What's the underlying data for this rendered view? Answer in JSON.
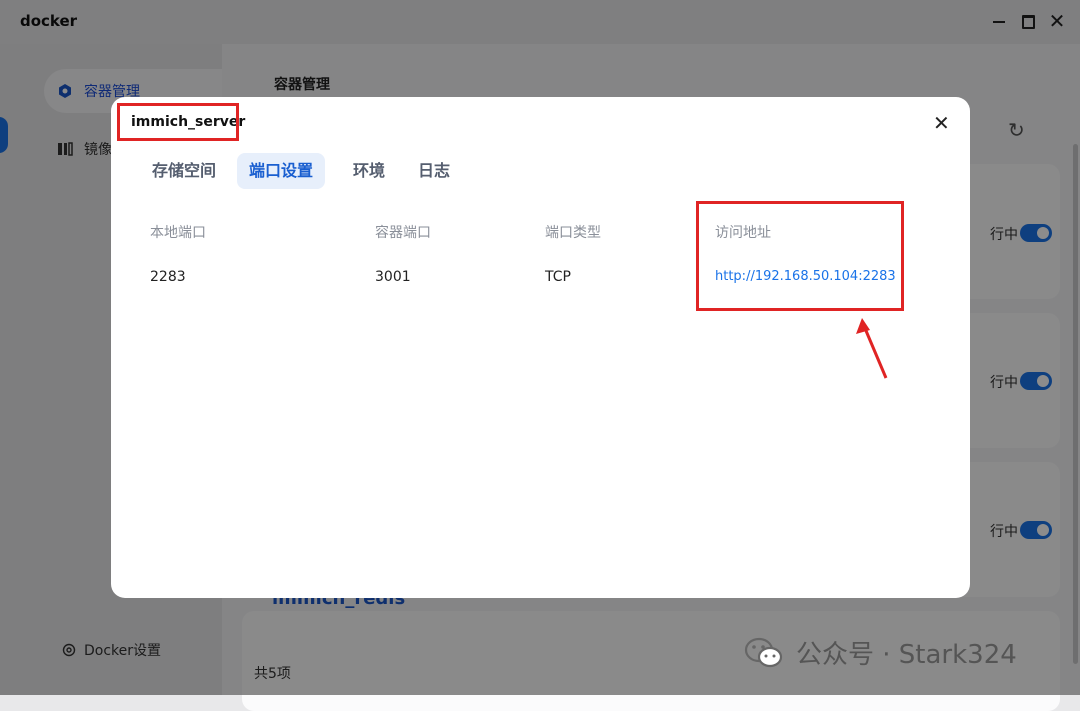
{
  "window": {
    "title": "docker"
  },
  "sidebar": {
    "items": [
      {
        "label": "容器管理",
        "icon": "hexagon-icon",
        "active": true
      },
      {
        "label": "镜像",
        "icon": "image-stack-icon",
        "active": false
      }
    ],
    "settings_label": "Docker设置"
  },
  "main": {
    "title": "容器管理",
    "status_label": "行中",
    "visible_card_name": "immich_redis",
    "total_label": "共5项"
  },
  "dialog": {
    "title": "immich_server",
    "tabs": [
      {
        "label": "存储空间",
        "active": false
      },
      {
        "label": "端口设置",
        "active": true
      },
      {
        "label": "环境",
        "active": false
      },
      {
        "label": "日志",
        "active": false
      }
    ],
    "table": {
      "columns": [
        "本地端口",
        "容器端口",
        "端口类型",
        "访问地址"
      ],
      "rows": [
        {
          "local_port": "2283",
          "container_port": "3001",
          "type": "TCP",
          "address": "http://192.168.50.104:2283"
        }
      ]
    }
  },
  "watermark": {
    "text": "公众号 · Stark324"
  },
  "colors": {
    "accent": "#1a73e8",
    "annotation": "#e02424"
  }
}
